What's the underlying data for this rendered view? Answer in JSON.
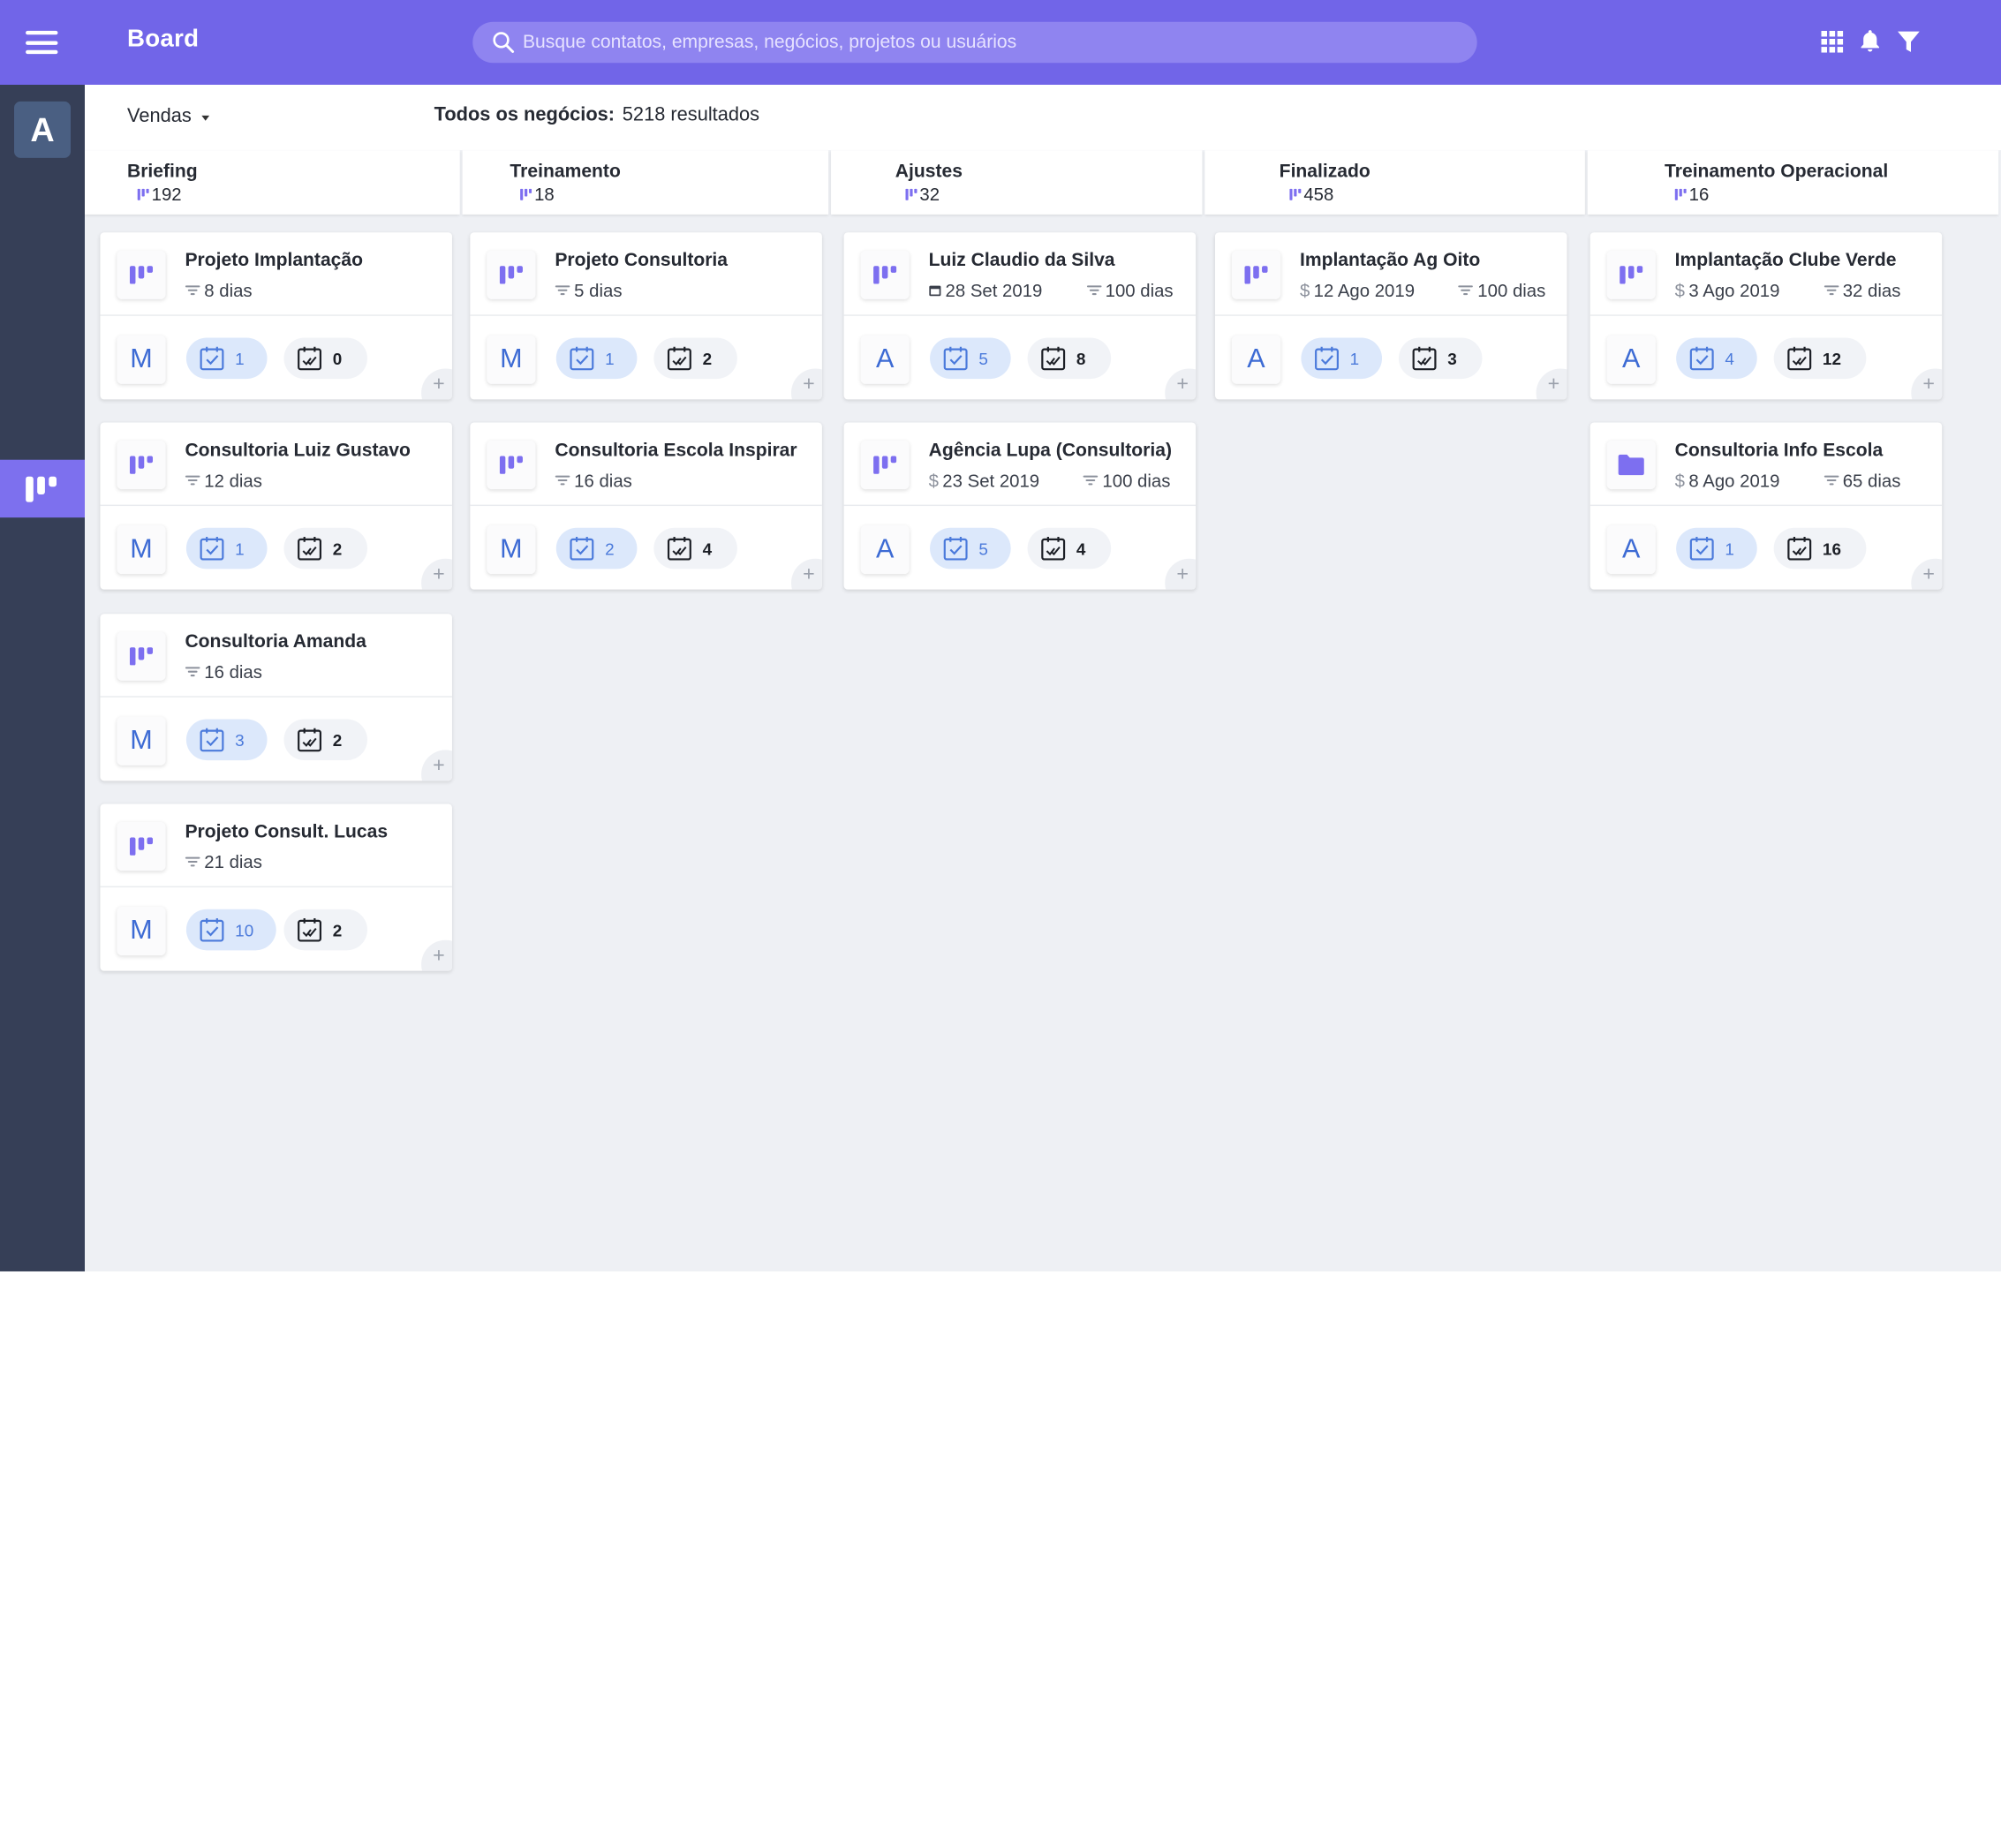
{
  "topbar": {
    "title": "Board",
    "search_placeholder": "Busque contatos, empresas, negócios, projetos ou usuários",
    "icons": [
      "apps-grid-icon",
      "bell-icon",
      "filter-icon"
    ]
  },
  "sidebar": {
    "account_initial": "A",
    "active_item": "board-icon"
  },
  "filterbar": {
    "pipeline": "Vendas",
    "results_label": "Todos os negócios:",
    "results_value": "5218 resultados"
  },
  "colors": {
    "accent": "#7165e8",
    "sidebar": "#363f57",
    "avatar_text": "#3d6bd4",
    "task_pill": "#dce8fb"
  },
  "columns": [
    {
      "name": "Briefing",
      "count": "192",
      "cards": [
        {
          "title": "Projeto Implantação",
          "icon": "board-icon",
          "meta": [
            {
              "icon": "filter-lines-icon",
              "text": "8 dias"
            }
          ],
          "avatar": "M",
          "tasks": "1",
          "done": "0"
        },
        {
          "title": "Consultoria Luiz Gustavo",
          "icon": "board-icon",
          "meta": [
            {
              "icon": "filter-lines-icon",
              "text": "12 dias"
            }
          ],
          "avatar": "M",
          "tasks": "1",
          "done": "2"
        },
        {
          "title": "Consultoria Amanda",
          "icon": "board-icon",
          "meta": [
            {
              "icon": "filter-lines-icon",
              "text": "16 dias"
            }
          ],
          "avatar": "M",
          "tasks": "3",
          "done": "2"
        },
        {
          "title": "Projeto Consult. Lucas",
          "icon": "board-icon",
          "meta": [
            {
              "icon": "filter-lines-icon",
              "text": "21 dias"
            }
          ],
          "avatar": "M",
          "tasks": "10",
          "done": "2"
        }
      ]
    },
    {
      "name": "Treinamento",
      "count": "18",
      "cards": [
        {
          "title": "Projeto Consultoria",
          "icon": "board-icon",
          "meta": [
            {
              "icon": "filter-lines-icon",
              "text": "5 dias"
            }
          ],
          "avatar": "M",
          "tasks": "1",
          "done": "2"
        },
        {
          "title": "Consultoria Escola Inspirar",
          "icon": "board-icon",
          "meta": [
            {
              "icon": "filter-lines-icon",
              "text": "16 dias"
            }
          ],
          "avatar": "M",
          "tasks": "2",
          "done": "4"
        }
      ]
    },
    {
      "name": "Ajustes",
      "count": "32",
      "cards": [
        {
          "title": "Luiz Claudio da Silva",
          "icon": "board-icon",
          "meta": [
            {
              "icon": "calendar-icon",
              "text": "28 Set 2019"
            },
            {
              "icon": "filter-lines-icon",
              "text": "100 dias"
            }
          ],
          "avatar": "A",
          "tasks": "5",
          "done": "8"
        },
        {
          "title": "Agência Lupa (Consultoria)",
          "icon": "board-icon",
          "meta": [
            {
              "icon": "dollar-icon",
              "text": "23 Set 2019"
            },
            {
              "icon": "filter-lines-icon",
              "text": "100 dias"
            }
          ],
          "avatar": "A",
          "tasks": "5",
          "done": "4"
        }
      ]
    },
    {
      "name": "Finalizado",
      "count": "458",
      "cards": [
        {
          "title": "Implantação Ag Oito",
          "icon": "board-icon",
          "meta": [
            {
              "icon": "dollar-icon",
              "text": "12 Ago 2019"
            },
            {
              "icon": "filter-lines-icon",
              "text": "100 dias"
            }
          ],
          "avatar": "A",
          "tasks": "1",
          "done": "3"
        }
      ]
    },
    {
      "name": "Treinamento Operacional",
      "count": "16",
      "cards": [
        {
          "title": "Implantação Clube Verde",
          "icon": "board-icon",
          "meta": [
            {
              "icon": "dollar-icon",
              "text": "3 Ago 2019"
            },
            {
              "icon": "filter-lines-icon",
              "text": "32 dias"
            }
          ],
          "avatar": "A",
          "tasks": "4",
          "done": "12"
        },
        {
          "title": "Consultoria Info Escola",
          "icon": "folder-icon",
          "meta": [
            {
              "icon": "dollar-icon",
              "text": "8 Ago 2019"
            },
            {
              "icon": "filter-lines-icon",
              "text": "65 dias"
            }
          ],
          "avatar": "A",
          "tasks": "1",
          "done": "16"
        }
      ]
    }
  ]
}
